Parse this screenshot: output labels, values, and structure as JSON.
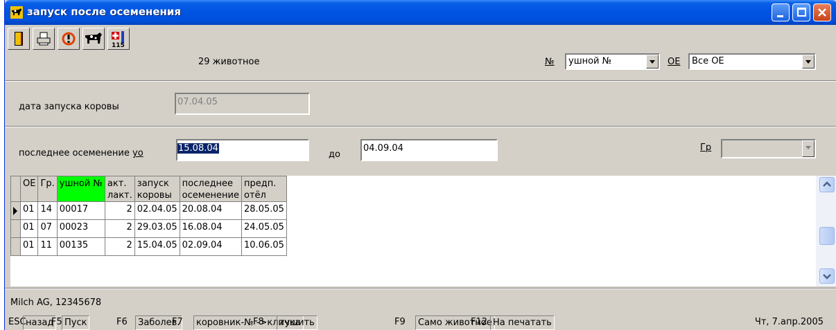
{
  "window": {
    "title": "запуск после осеменения"
  },
  "toolbar": {
    "animal_count": "29 животное",
    "number_label": "№",
    "number_select_value": "ушной №",
    "oe_label": "ОЕ",
    "oe_select_value": "Все ОЕ"
  },
  "form": {
    "cow_launch_date_label": "дата запуска коровы",
    "cow_launch_date_value": "07.04.05",
    "last_insemination_label": "последнее осеменение",
    "last_insemination_hotkey": "уо",
    "from_value": "15.08.04",
    "to_label": "до",
    "to_value": "04.09.04",
    "group_label": "Гр",
    "group_value": ""
  },
  "grid": {
    "headers": [
      [
        "ОЕ",
        ""
      ],
      [
        "Гр.",
        ""
      ],
      [
        "ушной №",
        ""
      ],
      [
        "акт.",
        "лакт."
      ],
      [
        "запуск",
        "коровы"
      ],
      [
        "последнее",
        "осеменение"
      ],
      [
        "предп.",
        "отёл"
      ]
    ],
    "rows": [
      {
        "current": true,
        "cells": [
          "01",
          "14",
          "00017",
          "2",
          "02.04.05",
          "20.08.04",
          "28.05.05"
        ]
      },
      {
        "current": false,
        "cells": [
          "01",
          "07",
          "00023",
          "2",
          "29.03.05",
          "16.08.04",
          "24.05.05"
        ]
      },
      {
        "current": false,
        "cells": [
          "01",
          "11",
          "00135",
          "2",
          "15.04.05",
          "02.09.04",
          "10.06.05"
        ]
      }
    ]
  },
  "status": {
    "company": "Milch AG, 12345678",
    "fkeys": [
      {
        "key": "ESC",
        "label": "назад"
      },
      {
        "key": "F5",
        "label": "Пуск"
      },
      {
        "key": "F6",
        "label": "Заболев."
      },
      {
        "key": "F7",
        "label": "коровник-№ ->кличка"
      },
      {
        "key": "F8",
        "label": "тушить"
      },
      {
        "key": "F9",
        "label": "Само животное"
      },
      {
        "key": "F12",
        "label": "На печатать"
      }
    ],
    "date": "Чт, 7.апр.2005"
  },
  "colors": {
    "title_bar": "#0054e3",
    "highlight_header": "#00ff00",
    "selection": "#0a246a"
  },
  "icons": [
    "exit-door-icon",
    "printer-icon",
    "refresh-icon",
    "cow-icon",
    "medical-kit-icon"
  ]
}
